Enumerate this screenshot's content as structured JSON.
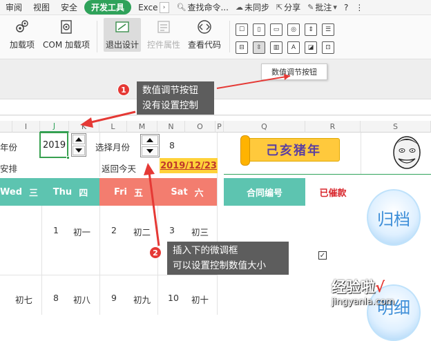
{
  "menu": {
    "items": [
      "审阅",
      "视图",
      "安全",
      "开发工具",
      "Exce"
    ],
    "active": "开发工具",
    "search": "查找命令...",
    "sync": "未同步",
    "share": "分享",
    "comment": "批注",
    "help": "?"
  },
  "ribbon": {
    "addins": "加载项",
    "com_addins": "COM 加载项",
    "exit_design": "退出设计",
    "control_props": "控件属性",
    "view_code": "查看代码"
  },
  "tooltip": "数值调节按钮",
  "callouts": {
    "one_badge": "1",
    "one_line1": "数值调节按钮",
    "one_line2": "没有设置控制",
    "two_badge": "2",
    "two_line1": "插入下的微调框",
    "two_line2": "可以设置控制数值大小"
  },
  "columns": [
    "I",
    "J",
    "K",
    "L",
    "M",
    "N",
    "O",
    "P",
    "Q",
    "R",
    "S"
  ],
  "sheet": {
    "year_label": "年份",
    "year_value": "2019",
    "arrange_label": "安排",
    "month_label": "选择月份",
    "month_value": "8",
    "back_today": "返回今天",
    "today_date": "2019/12/23",
    "banner": "己亥猪年",
    "week": {
      "wed": "Wed",
      "wed_cn": "三",
      "thu": "Thu",
      "thu_cn": "四",
      "fri": "Fri",
      "fri_cn": "五",
      "sat": "Sat",
      "sat_cn": "六"
    },
    "contract_no": "合同编号",
    "collected": "已催款",
    "row1": [
      "1",
      "初一",
      "2",
      "初二",
      "3",
      "初三"
    ],
    "row2": [
      "初七",
      "8",
      "初八",
      "9",
      "初九",
      "10",
      "初十"
    ],
    "archive": "归档",
    "detail": "明细",
    "check_mark": "✓"
  },
  "watermark": {
    "line1": "经验啦",
    "check": "√",
    "line2": "jingyanla.com"
  },
  "colors": {
    "accent_green": "#2fa25a",
    "thu_teal": "#5dc4b0",
    "fri_salmon": "#f37d6f",
    "date_yellow": "#ffd23a",
    "badge_red": "#e53935"
  }
}
